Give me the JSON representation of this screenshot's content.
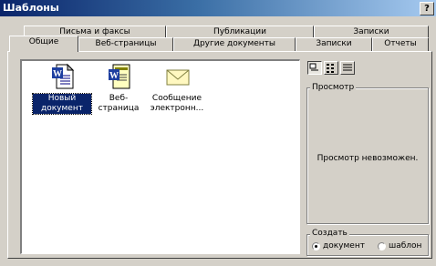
{
  "window": {
    "title": "Шаблоны",
    "help_label": "?"
  },
  "tabs_back": [
    "Письма и факсы",
    "Публикации",
    "Записки"
  ],
  "tabs_front": [
    "Общие",
    "Веб-страницы",
    "Другие документы",
    "Записки",
    "Отчеты"
  ],
  "templates": [
    {
      "label_line1": "Новый",
      "label_line2": "документ",
      "icon": "word-document-icon",
      "selected": true
    },
    {
      "label_line1": "Веб-страница",
      "label_line2": "",
      "icon": "word-web-page-icon",
      "selected": false
    },
    {
      "label_line1": "Сообщение",
      "label_line2": "электронн...",
      "icon": "email-envelope-icon",
      "selected": false
    }
  ],
  "view_buttons": [
    "large-icons-icon",
    "list-view-icon",
    "details-view-icon"
  ],
  "preview": {
    "title": "Просмотр",
    "message": "Просмотр невозможен."
  },
  "create": {
    "title": "Создать",
    "option_document": "документ",
    "option_template": "шаблон",
    "selected": "документ"
  }
}
